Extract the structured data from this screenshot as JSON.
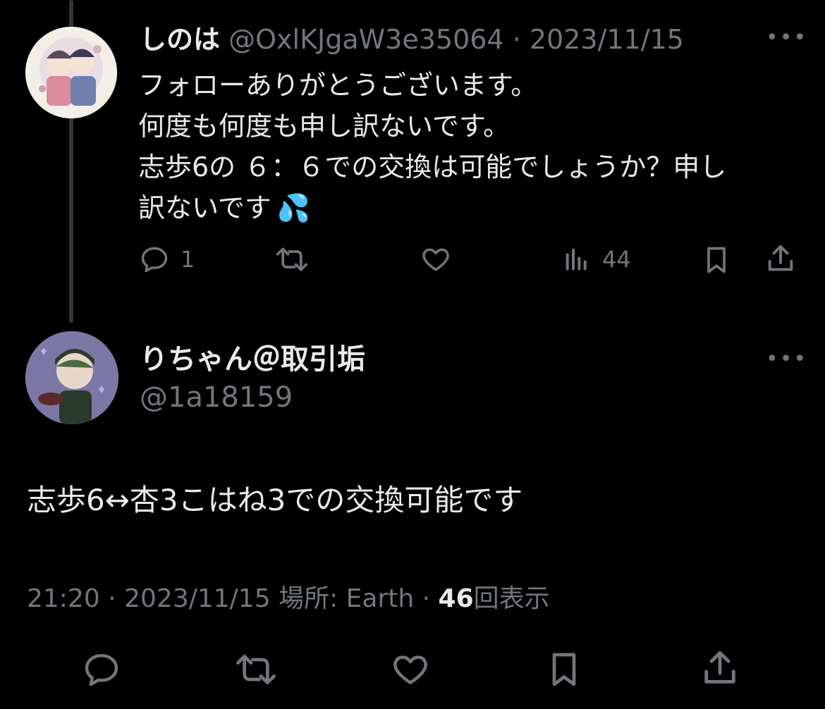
{
  "reply_tweet": {
    "display_name": "しのは",
    "handle": "@OxlKJgaW3e35064",
    "separator": "·",
    "date": "2023/11/15",
    "more_label": "•••",
    "lines": [
      "フォローありがとうございます。",
      "何度も何度も申し訳ないです。",
      "志歩6の ６：６での交換は可能でしょうか？申し",
      "訳ないです"
    ],
    "emoji": "💦",
    "reply_count": "1",
    "retweet_count": "",
    "like_count": "",
    "view_count": "44"
  },
  "main_tweet": {
    "display_name": "りちゃん＠取引垢",
    "handle": "@1a18159",
    "more_label": "•••",
    "text": "志歩6↔杏3こはね3での交換可能です",
    "time": "21:20",
    "sep1": "·",
    "date": "2023/11/15",
    "location": "場所: Earth",
    "sep2": "·",
    "views": "46",
    "views_label": "回表示"
  }
}
